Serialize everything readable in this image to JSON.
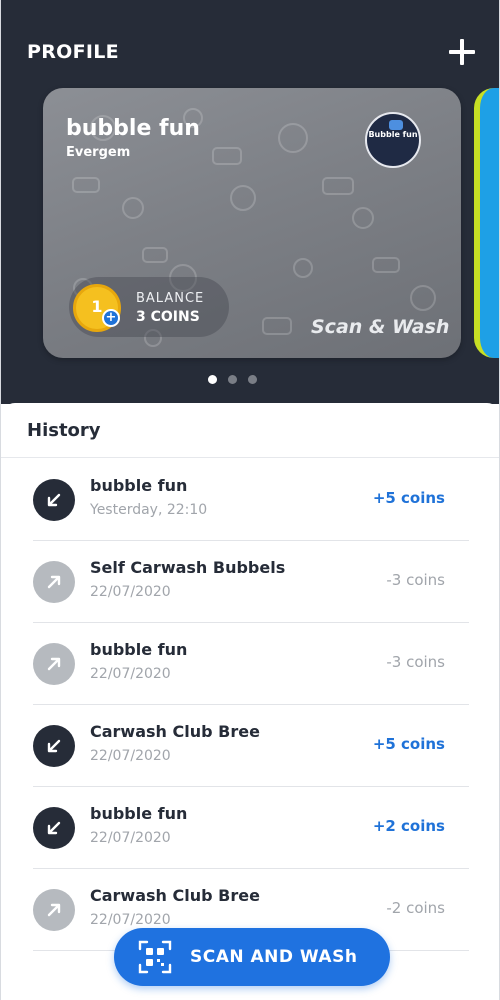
{
  "header": {
    "title": "PROFILE",
    "add_icon": "plus-icon"
  },
  "card": {
    "title": "bubble fun",
    "subtitle": "Evergem",
    "logo_text": "Bubble fun",
    "balance_label": "BALANCE",
    "balance_value": "3 COINS",
    "coin_number": "1",
    "coin_badge": "+",
    "tagline": "Scan & Wash"
  },
  "carousel": {
    "pages": 3,
    "active": 1
  },
  "history": {
    "title": "History",
    "items": [
      {
        "name": "bubble fun",
        "date": "Yesterday, 22:10",
        "amount": "+5 coins",
        "direction": "in"
      },
      {
        "name": "Self Carwash Bubbels",
        "date": "22/07/2020",
        "amount": "-3 coins",
        "direction": "out"
      },
      {
        "name": "bubble fun",
        "date": "22/07/2020",
        "amount": "-3 coins",
        "direction": "out"
      },
      {
        "name": "Carwash Club Bree",
        "date": "22/07/2020",
        "amount": "+5 coins",
        "direction": "in"
      },
      {
        "name": "bubble fun",
        "date": "22/07/2020",
        "amount": "+2 coins",
        "direction": "in"
      },
      {
        "name": "Carwash Club Bree",
        "date": "22/07/2020",
        "amount": "-2 coins",
        "direction": "out"
      }
    ]
  },
  "scan_button": {
    "label": "SCAN AND WASh",
    "icon": "qr-scan-icon"
  },
  "colors": {
    "header_bg": "#262c38",
    "accent_blue": "#1f72e0",
    "positive": "#1f72d8",
    "neutral": "#a1a5ab",
    "coin": "#f5c01f"
  }
}
